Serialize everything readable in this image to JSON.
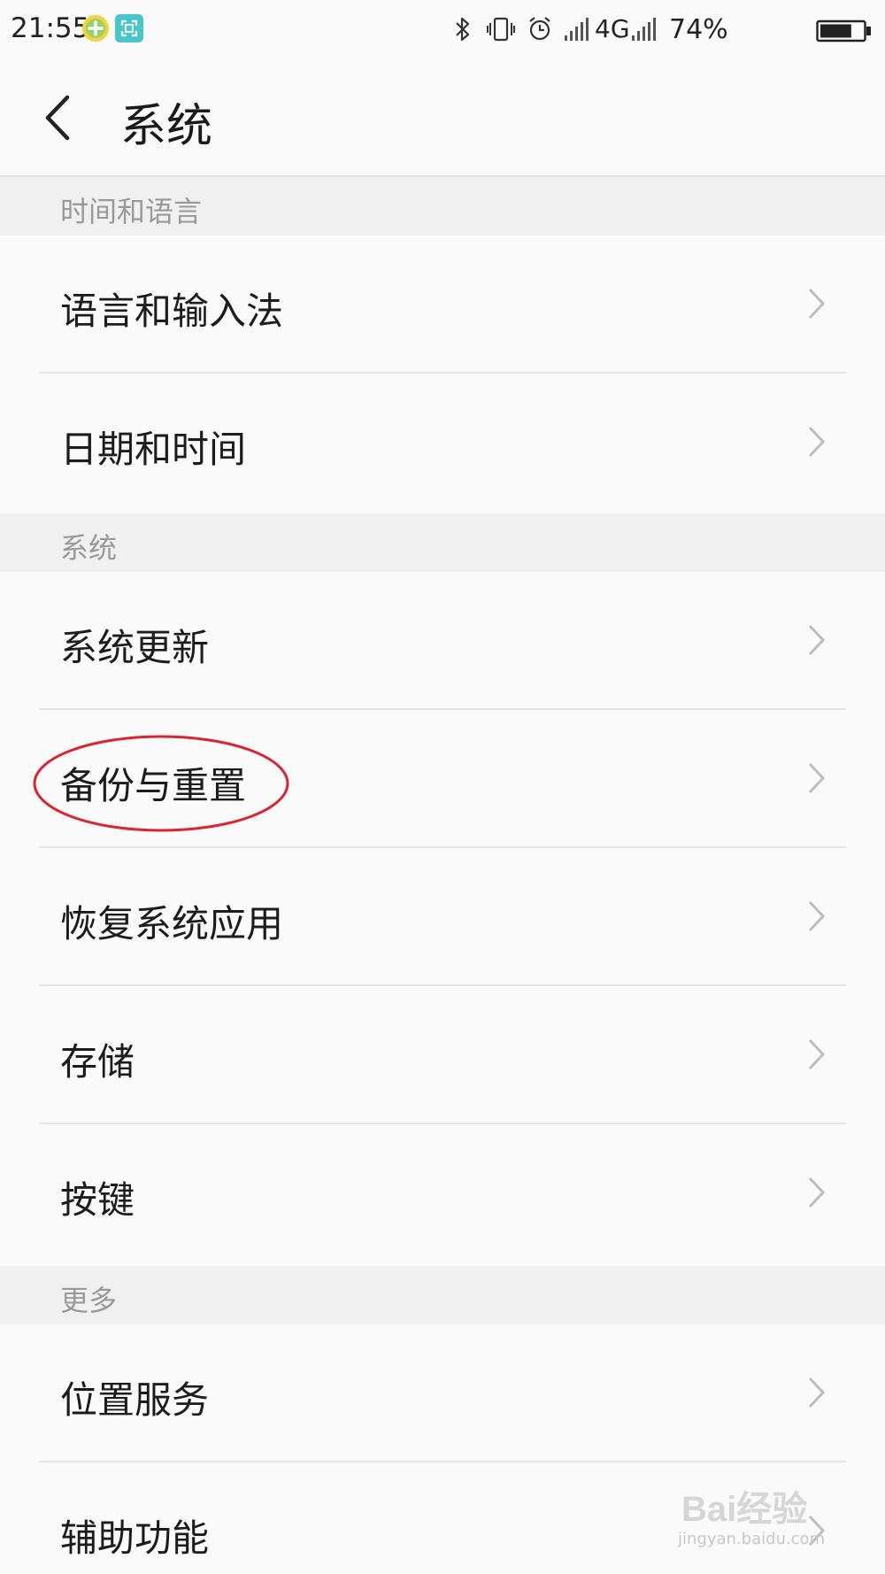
{
  "status_bar": {
    "time": "21:55",
    "network": "4G",
    "battery": "74%",
    "battery_level": 0.74,
    "icons": [
      "app-notification-icon",
      "screenshot-icon",
      "bluetooth-icon",
      "vibrate-icon",
      "alarm-icon",
      "signal-icon",
      "signal-icon",
      "battery-icon"
    ]
  },
  "header": {
    "back_icon": "chevron-left-icon",
    "title": "系统"
  },
  "sections": [
    {
      "label": "时间和语言",
      "items": [
        {
          "label": "语言和输入法"
        },
        {
          "label": "日期和时间"
        }
      ]
    },
    {
      "label": "系统",
      "items": [
        {
          "label": "系统更新"
        },
        {
          "label": "备份与重置"
        },
        {
          "label": "恢复系统应用"
        },
        {
          "label": "存储"
        },
        {
          "label": "按键"
        }
      ]
    },
    {
      "label": "更多",
      "items": [
        {
          "label": "位置服务"
        },
        {
          "label": "辅助功能"
        }
      ]
    }
  ],
  "annotation": {
    "highlighted_item": "备份与重置",
    "color": "#d9262e"
  },
  "watermark": {
    "text": "Bai经验",
    "url": "jingyan.baidu.com"
  },
  "colors": {
    "background": "#fafafa",
    "section_background": "#f0f0f0",
    "section_text": "#999999",
    "item_text": "#1c1c1c",
    "chevron": "#bdbdbd",
    "divider": "#e6e6e6"
  }
}
